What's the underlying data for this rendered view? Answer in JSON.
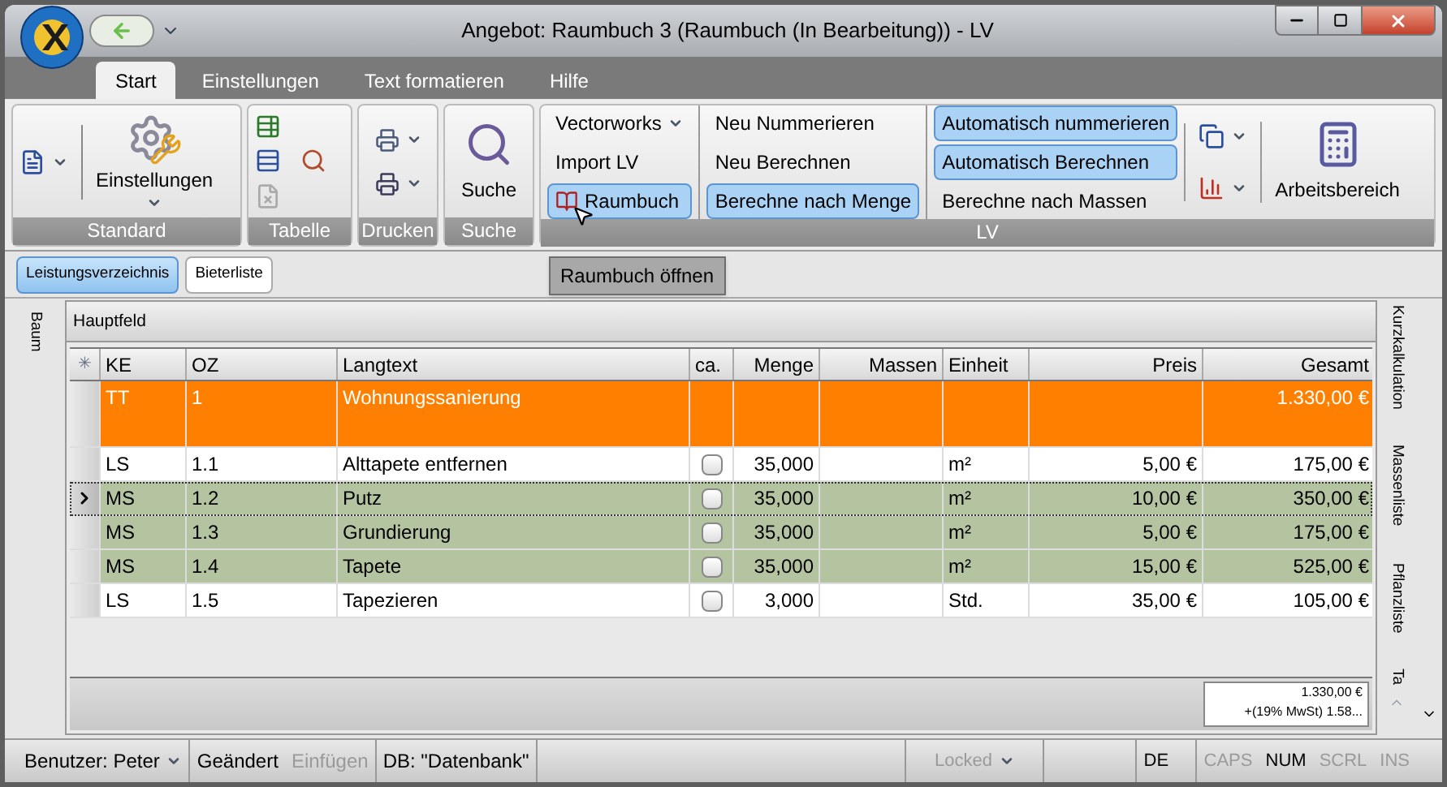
{
  "window": {
    "title": "Angebot: Raumbuch 3  (Raumbuch  (In Bearbeitung)) - LV"
  },
  "ribbon_tabs": [
    {
      "label": "Start",
      "selected": true
    },
    {
      "label": "Einstellungen",
      "selected": false
    },
    {
      "label": "Text formatieren",
      "selected": false
    },
    {
      "label": "Hilfe",
      "selected": false
    }
  ],
  "ribbon_groups": {
    "standard": {
      "label": "Standard",
      "button": "Einstellungen"
    },
    "tabelle": {
      "label": "Tabelle"
    },
    "drucken": {
      "label": "Drucken"
    },
    "suche": {
      "label": "Suche",
      "button": "Suche"
    },
    "lv": {
      "label": "LV",
      "columns": [
        [
          {
            "label": "Vectorworks",
            "dropdown": true,
            "highlighted": false
          },
          {
            "label": "Import LV",
            "dropdown": false,
            "highlighted": false
          },
          {
            "label": "Raumbuch",
            "dropdown": false,
            "highlighted": true,
            "kind": "book"
          }
        ],
        [
          {
            "label": "Neu Nummerieren",
            "dropdown": false,
            "highlighted": false
          },
          {
            "label": "Neu Berechnen",
            "dropdown": false,
            "highlighted": false
          },
          {
            "label": "Berechne nach Menge",
            "dropdown": false,
            "highlighted": true
          }
        ],
        [
          {
            "label": "Automatisch nummerieren",
            "dropdown": false,
            "highlighted": true
          },
          {
            "label": "Automatisch Berechnen",
            "dropdown": false,
            "highlighted": true
          },
          {
            "label": "Berechne nach Massen",
            "dropdown": false,
            "highlighted": false
          }
        ]
      ],
      "workspace_button": "Arbeitsbereich"
    }
  },
  "tooltip": "Raumbuch öffnen",
  "doc_tabs": [
    {
      "label": "Leistungsverzeichnis",
      "selected": true
    },
    {
      "label": "Bieterliste",
      "selected": false
    }
  ],
  "left_tab": "Baum",
  "grid": {
    "caption": "Hauptfeld",
    "corner": "✳",
    "columns": [
      "KE",
      "OZ",
      "Langtext",
      "ca.",
      "Menge",
      "Massen",
      "Einheit",
      "Preis",
      "Gesamt"
    ],
    "rows": [
      {
        "kind": "heading",
        "selected": false,
        "ke": "TT",
        "oz": "1",
        "langtext": "Wohnungssanierung",
        "menge": "",
        "einheit": "",
        "preis": "",
        "gesamt": "1.330,00 €"
      },
      {
        "kind": "standard",
        "selected": false,
        "checked": false,
        "ke": "LS",
        "oz": "1.1",
        "langtext": "Alttapete entfernen",
        "menge": "35,000",
        "einheit": "m²",
        "preis": "5,00 €",
        "gesamt": "175,00 €"
      },
      {
        "kind": "marked",
        "selected": true,
        "checked": false,
        "ke": "MS",
        "oz": "1.2",
        "langtext": "Putz",
        "menge": "35,000",
        "einheit": "m²",
        "preis": "10,00 €",
        "gesamt": "350,00 €"
      },
      {
        "kind": "marked",
        "selected": false,
        "checked": false,
        "ke": "MS",
        "oz": "1.3",
        "langtext": "Grundierung",
        "menge": "35,000",
        "einheit": "m²",
        "preis": "5,00 €",
        "gesamt": "175,00 €"
      },
      {
        "kind": "marked",
        "selected": false,
        "checked": false,
        "ke": "MS",
        "oz": "1.4",
        "langtext": "Tapete",
        "menge": "35,000",
        "einheit": "m²",
        "preis": "15,00 €",
        "gesamt": "525,00 €"
      },
      {
        "kind": "standard",
        "selected": false,
        "checked": false,
        "ke": "LS",
        "oz": "1.5",
        "langtext": "Tapezieren",
        "menge": "3,000",
        "einheit": "Std.",
        "preis": "35,00 €",
        "gesamt": "105,00 €"
      }
    ],
    "summary": [
      "1.330,00 €",
      "+(19% MwSt) 1.58..."
    ]
  },
  "right_tabs": [
    "Kurzkalkulation",
    "Massenliste",
    "Pflanzliste",
    "Ta"
  ],
  "status_bar": {
    "left": [
      {
        "label": "Benutzer: Peter",
        "dropdown": true,
        "disabled": false
      },
      {
        "label": "Geändert",
        "dropdown": false,
        "disabled": false
      },
      {
        "label": "Einfügen",
        "dropdown": false,
        "disabled": true
      },
      {
        "label": "DB: \"Datenbank\"",
        "dropdown": false,
        "disabled": false
      }
    ],
    "right": [
      {
        "label": "Locked",
        "dropdown": true,
        "disabled": true
      },
      {
        "label": "DE",
        "dropdown": false,
        "disabled": false
      },
      {
        "label": "CAPS",
        "dropdown": false,
        "disabled": true
      },
      {
        "label": "NUM",
        "dropdown": false,
        "disabled": false
      },
      {
        "label": "SCRL",
        "dropdown": false,
        "disabled": true
      },
      {
        "label": "INS",
        "dropdown": false,
        "disabled": true
      }
    ]
  }
}
